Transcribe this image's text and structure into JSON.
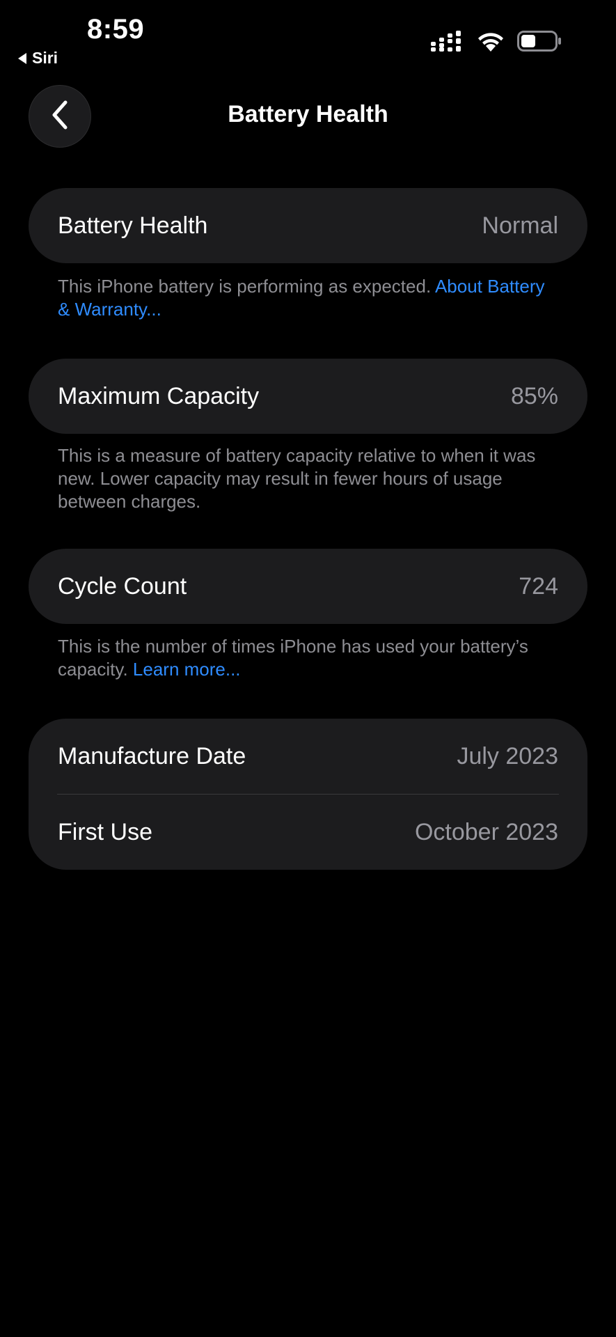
{
  "status_bar": {
    "time": "8:59",
    "back_app": "Siri",
    "icons": [
      "cellular-signal-icon",
      "wifi-icon",
      "battery-icon"
    ]
  },
  "nav": {
    "title": "Battery Health",
    "back_icon": "chevron-left-icon"
  },
  "battery_health": {
    "label": "Battery Health",
    "value": "Normal",
    "footnote": "This iPhone battery is performing as expected. ",
    "footnote_link": "About Battery & Warranty..."
  },
  "max_capacity": {
    "label": "Maximum Capacity",
    "value": "85%",
    "footnote": "This is a measure of battery capacity relative to when it was new. Lower capacity may result in fewer hours of usage between charges."
  },
  "cycle_count": {
    "label": "Cycle Count",
    "value": "724",
    "footnote": "This is the number of times iPhone has used your battery’s capacity. ",
    "footnote_link": "Learn more..."
  },
  "dates": {
    "manufacture_label": "Manufacture Date",
    "manufacture_value": "July 2023",
    "first_use_label": "First Use",
    "first_use_value": "October 2023"
  },
  "colors": {
    "background": "#000000",
    "group_bg": "#1c1c1e",
    "secondary_text": "#98989f",
    "link": "#2f8cff"
  }
}
